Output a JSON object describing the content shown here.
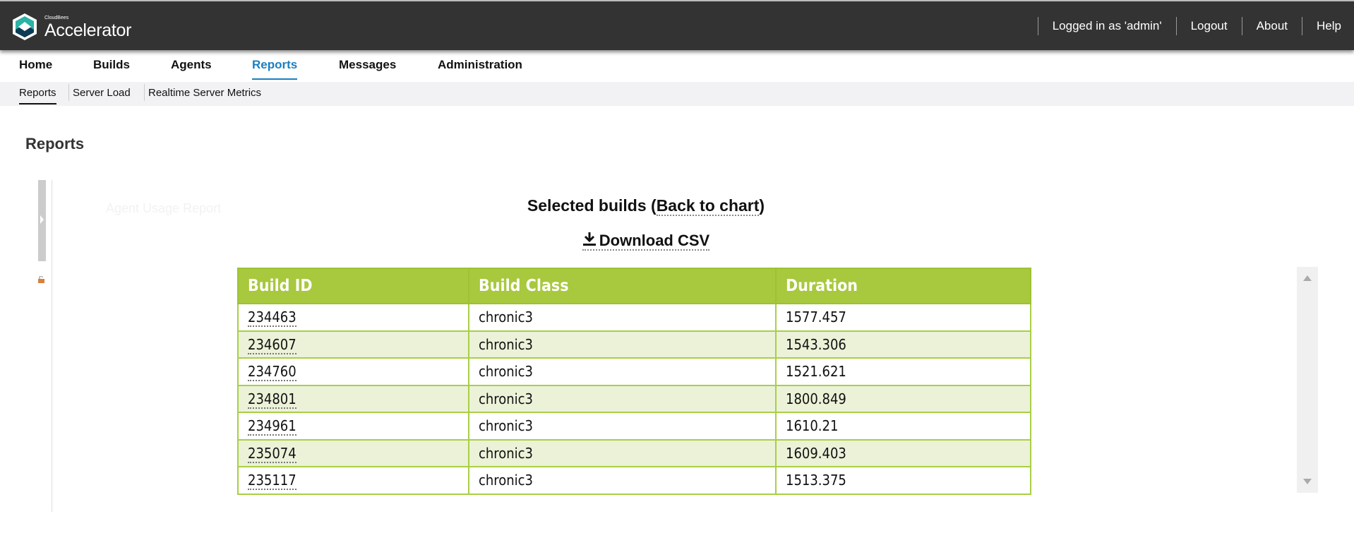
{
  "header": {
    "brand_small": "CloudBees",
    "brand": "Accelerator",
    "logged_in": "Logged in as 'admin'",
    "logout": "Logout",
    "about": "About",
    "help": "Help"
  },
  "nav": [
    {
      "label": "Home"
    },
    {
      "label": "Builds"
    },
    {
      "label": "Agents"
    },
    {
      "label": "Reports",
      "active": true
    },
    {
      "label": "Messages"
    },
    {
      "label": "Administration"
    }
  ],
  "subnav": [
    {
      "label": "Reports",
      "active": true
    },
    {
      "label": "Server Load"
    },
    {
      "label": "Realtime Server Metrics"
    }
  ],
  "page_title": "Reports",
  "panel": {
    "title_prefix": "Selected builds (",
    "back_link": "Back to chart",
    "title_suffix": ")",
    "download": "Download CSV",
    "ghost_title": "Agent Usage Report"
  },
  "table": {
    "columns": [
      "Build ID",
      "Build Class",
      "Duration"
    ],
    "rows": [
      [
        "234463",
        "chronic3",
        "1577.457"
      ],
      [
        "234607",
        "chronic3",
        "1543.306"
      ],
      [
        "234760",
        "chronic3",
        "1521.621"
      ],
      [
        "234801",
        "chronic3",
        "1800.849"
      ],
      [
        "234961",
        "chronic3",
        "1610.21"
      ],
      [
        "235074",
        "chronic3",
        "1609.403"
      ],
      [
        "235117",
        "chronic3",
        "1513.375"
      ]
    ]
  },
  "colors": {
    "header_bg": "#333333",
    "accent": "#1a7fc0",
    "table_header": "#a8c83e",
    "row_alt": "#ebf2d8"
  }
}
